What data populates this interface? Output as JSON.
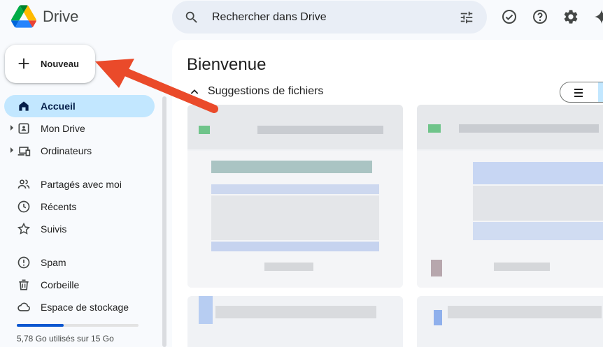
{
  "header": {
    "app_title": "Drive",
    "search_placeholder": "Rechercher dans Drive",
    "icons": [
      "search-icon",
      "search-options-icon",
      "offline-ready-icon",
      "help-icon",
      "settings-icon",
      "gemini-icon"
    ]
  },
  "new_button": {
    "label": "Nouveau"
  },
  "sidebar": {
    "items": [
      {
        "label": "Accueil",
        "icon": "home-icon",
        "active": true
      },
      {
        "label": "Mon Drive",
        "icon": "my-drive-icon",
        "expandable": true
      },
      {
        "label": "Ordinateurs",
        "icon": "computers-icon",
        "expandable": true
      },
      {
        "label": "Partagés avec moi",
        "icon": "shared-icon"
      },
      {
        "label": "Récents",
        "icon": "clock-icon"
      },
      {
        "label": "Suivis",
        "icon": "star-icon"
      },
      {
        "label": "Spam",
        "icon": "spam-icon"
      },
      {
        "label": "Corbeille",
        "icon": "trash-icon"
      },
      {
        "label": "Espace de stockage",
        "icon": "cloud-icon"
      }
    ],
    "storage": {
      "text": "5,78 Go utilisés sur 15 Go",
      "used_fraction": 0.385
    }
  },
  "main": {
    "title": "Bienvenue",
    "suggestions_title": "Suggestions de fichiers"
  },
  "colors": {
    "accent": "#0b57d0",
    "active_bg": "#c2e7ff",
    "arrow": "#ea4a2a"
  }
}
